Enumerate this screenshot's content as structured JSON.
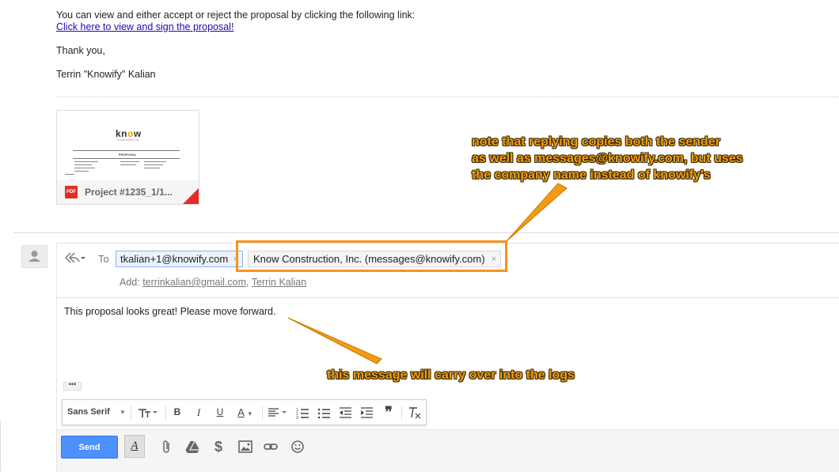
{
  "email": {
    "line1": "You can view and either accept or reject the proposal by clicking the following link:",
    "link": "Click here to view and sign the proposal!",
    "thanks": "Thank you,",
    "signature": "Terrin \"Knowify\" Kalian"
  },
  "attachment": {
    "name": "Project #1235_1/1...",
    "type_badge": "PDF",
    "logo_prefix": "kn",
    "logo_o": "o",
    "logo_suffix": "w",
    "logo_sub": "construction inc.",
    "doc_title": "PROPOSAL"
  },
  "reply": {
    "to_label": "To",
    "recipients": [
      {
        "label": "tkalian+1@knowify.com",
        "remove": "×"
      },
      {
        "label": "Know Construction, Inc. (messages@knowify.com)",
        "remove": "×"
      }
    ],
    "add_label": "Add:",
    "add_links": [
      "terrinkalian@gmail.com",
      "Terrin Kalian"
    ],
    "add_separator": ",",
    "body": "This proposal looks great! Please move forward.",
    "ellipsis": "•••"
  },
  "formatting": {
    "font": "Sans Serif",
    "bold": "B",
    "italic": "I",
    "underline": "U",
    "text_color": "A",
    "quote": "❞"
  },
  "toolbar": {
    "send_label": "Send",
    "format_toggle": "A",
    "money_icon": "$"
  },
  "annotations": {
    "note1_lines": [
      "note that replying copies both the sender",
      "as well as messages@knowify.com, but uses",
      "the company name instead of knowify's"
    ],
    "note2": "this message will carry over into the logs"
  },
  "colors": {
    "annotation": "#f39c12",
    "highlight": "#f7931e",
    "link": "#1a0dab",
    "send": "#4d90fe",
    "pdf": "#e52c23"
  }
}
